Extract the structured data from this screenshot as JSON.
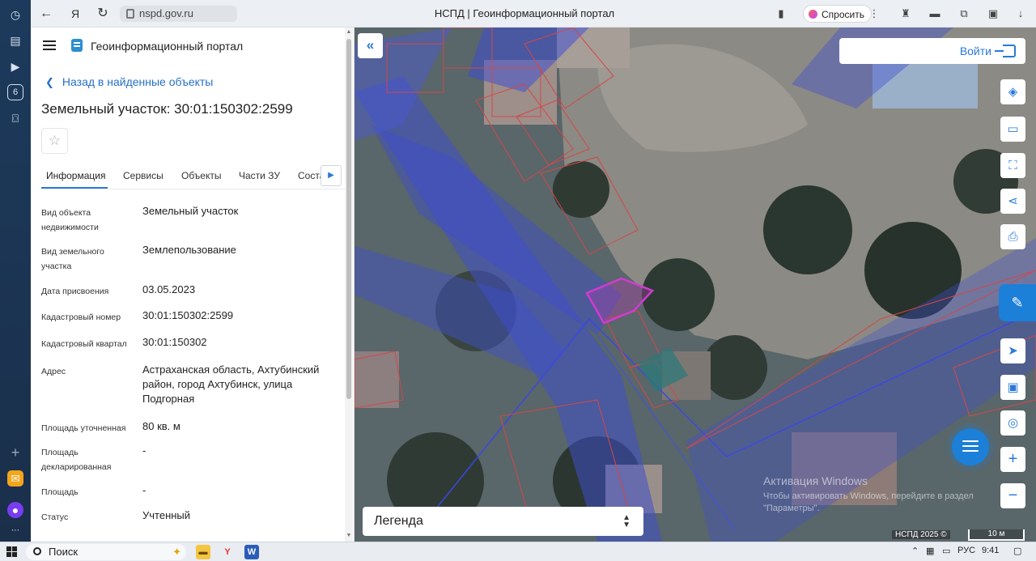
{
  "browser": {
    "url": "nspd.gov.ru",
    "tab_title": "НСПД | Геоинформационный портал",
    "ask_label": "Спросить"
  },
  "panel": {
    "portal_name": "Геоинформационный портал",
    "back_link": "Назад в найденные объекты",
    "title": "Земельный участок: 30:01:150302:2599",
    "tabs": [
      {
        "label": "Информация"
      },
      {
        "label": "Сервисы"
      },
      {
        "label": "Объекты"
      },
      {
        "label": "Части ЗУ"
      },
      {
        "label": "Соста"
      }
    ],
    "properties": [
      {
        "key": "Вид объекта недвижимости",
        "value": "Земельный участок"
      },
      {
        "key": "Вид земельного участка",
        "value": "Землепользование"
      },
      {
        "key": "Дата присвоения",
        "value": "03.05.2023"
      },
      {
        "key": "Кадастровый номер",
        "value": "30:01:150302:2599"
      },
      {
        "key": "Кадастровый квартал",
        "value": "30:01:150302"
      },
      {
        "key": "Адрес",
        "value": "Астраханская область, Ахтубинский район, город Ахтубинск, улица Подгорная"
      },
      {
        "key": "Площадь уточненная",
        "value": "80 кв. м"
      },
      {
        "key": "Площадь декларированная",
        "value": "-"
      },
      {
        "key": "Площадь",
        "value": "-"
      },
      {
        "key": "Статус",
        "value": "Учтенный"
      }
    ]
  },
  "map": {
    "login_label": "Войти",
    "legend_label": "Легенда",
    "watermark_title": "Активация Windows",
    "watermark_text": "Чтобы активировать Windows, перейдите в раздел \"Параметры\".",
    "copyright": "НСПД 2025 ©",
    "scale_label": "10 м"
  },
  "taskbar": {
    "search_placeholder": "Поиск",
    "lang": "РУС",
    "time": "9:41"
  }
}
